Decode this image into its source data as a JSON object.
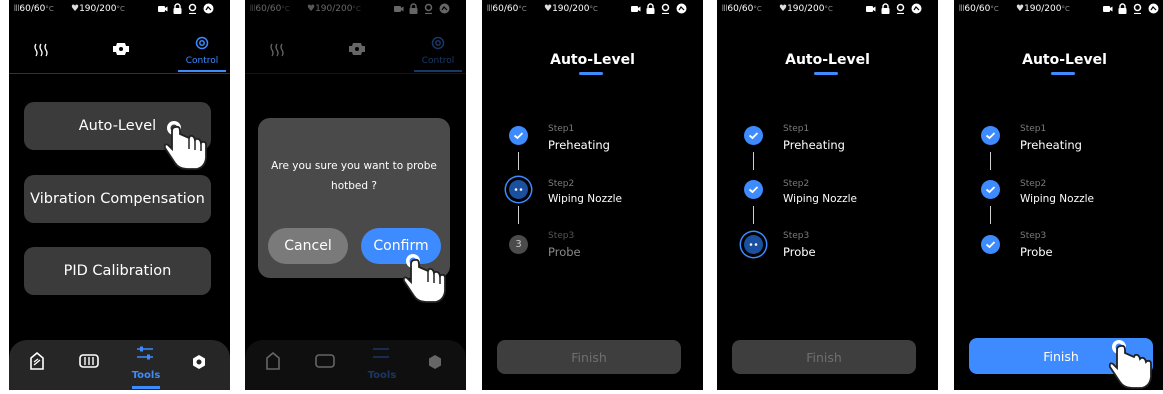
{
  "status": {
    "nozzle": "60/60",
    "bed": "190/200",
    "unit": "°C"
  },
  "screen1": {
    "tabs": [
      "",
      "",
      "Control"
    ],
    "buttons": [
      "Auto-Level",
      "Vibration Compensation",
      "PID Calibration"
    ],
    "bottom_nav": {
      "tools_label": "Tools"
    }
  },
  "screen2": {
    "message": "Are you sure you want to probe hotbed ?",
    "cancel": "Cancel",
    "confirm": "Confirm"
  },
  "autolevel": {
    "title": "Auto-Level",
    "steps": [
      {
        "sub": "Step1",
        "main": "Preheating"
      },
      {
        "sub": "Step2",
        "main": "Wiping Nozzle"
      },
      {
        "sub": "Step3",
        "main": "Probe",
        "num": "3"
      }
    ],
    "finish": "Finish"
  },
  "colors": {
    "accent": "#3d8bff",
    "background": "#000000",
    "button": "#3b3b3b"
  },
  "icons": {
    "status": [
      "nozzle-temp-icon",
      "bed-temp-icon",
      "camera-icon",
      "lock-icon",
      "location-icon",
      "cloud-icon"
    ],
    "tabs": [
      "heat-icon",
      "fan-icon",
      "control-gear-icon"
    ],
    "bottom_nav": [
      "print-icon",
      "filament-icon",
      "tools-icon",
      "settings-icon"
    ]
  }
}
